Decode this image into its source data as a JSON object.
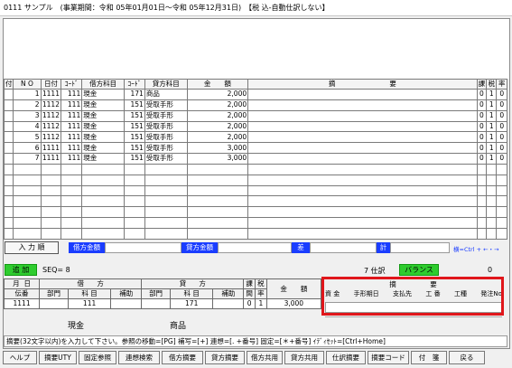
{
  "title": "0111 サンプル　(事業期間：令和 05年01月01日～令和 05年12月31日)　【税 込-自動仕訳しない】",
  "grid": {
    "headers": [
      "付",
      "N O",
      "日付",
      "ｺｰﾄﾞ",
      "借方科目",
      "ｺｰﾄﾞ",
      "貸方科目",
      "金　　額",
      "摘　　　　　　　　要",
      "課",
      "税",
      "率"
    ],
    "rows": [
      {
        "no": "1",
        "date": "1111",
        "dcode": "111",
        "dname": "現金",
        "ccode": "171",
        "cname": "商品",
        "amount": "2,000",
        "desc": "",
        "ka": "0",
        "zei": "1",
        "ritsu": "0"
      },
      {
        "no": "2",
        "date": "1112",
        "dcode": "111",
        "dname": "現金",
        "ccode": "151",
        "cname": "受取手形",
        "amount": "2,000",
        "desc": "",
        "ka": "0",
        "zei": "1",
        "ritsu": "0"
      },
      {
        "no": "3",
        "date": "1112",
        "dcode": "111",
        "dname": "現金",
        "ccode": "151",
        "cname": "受取手形",
        "amount": "2,000",
        "desc": "",
        "ka": "0",
        "zei": "1",
        "ritsu": "0"
      },
      {
        "no": "4",
        "date": "1112",
        "dcode": "111",
        "dname": "現金",
        "ccode": "151",
        "cname": "受取手形",
        "amount": "2,000",
        "desc": "",
        "ka": "0",
        "zei": "1",
        "ritsu": "0"
      },
      {
        "no": "5",
        "date": "1112",
        "dcode": "111",
        "dname": "現金",
        "ccode": "151",
        "cname": "受取手形",
        "amount": "2,000",
        "desc": "",
        "ka": "0",
        "zei": "1",
        "ritsu": "0"
      },
      {
        "no": "6",
        "date": "1111",
        "dcode": "111",
        "dname": "現金",
        "ccode": "151",
        "cname": "受取手形",
        "amount": "3,000",
        "desc": "",
        "ka": "0",
        "zei": "1",
        "ritsu": "0"
      },
      {
        "no": "7",
        "date": "1111",
        "dcode": "111",
        "dname": "現金",
        "ccode": "151",
        "cname": "受取手形",
        "amount": "3,000",
        "desc": "",
        "ka": "0",
        "zei": "1",
        "ritsu": "0"
      }
    ],
    "empty_rows": 7
  },
  "input_bar": {
    "order_button": "入 力 順",
    "debit_amount_label": "借方金額",
    "credit_amount_label": "貸方金額",
    "diff_label": "差",
    "total_label": "計",
    "shortcut": "横=Ctrl + ←・→"
  },
  "status": {
    "add_mode": "追 加",
    "seq": "SEQ= 8",
    "entry_count": "7 仕訳",
    "balance_button": "バランス",
    "balance_value": "0"
  },
  "entry": {
    "header1": [
      "月",
      "日",
      "借",
      "方",
      "貸",
      "方",
      "課",
      "税"
    ],
    "header2": [
      "伝番",
      "部門",
      "科 目",
      "補助",
      "部門",
      "科 目",
      "補助",
      "間",
      "率",
      "金　　額"
    ],
    "values": {
      "date": "1111",
      "dcode": "111",
      "ccode": "171",
      "ka": "0",
      "zei": "1",
      "amount": "3,000"
    },
    "debit_name": "現金",
    "credit_name": "商品",
    "tekiyo_title": "摘　　　　　要",
    "tekiyo_cols": [
      "資 金",
      "手形期日",
      "支払先",
      "工 番",
      "工種",
      "発注No"
    ]
  },
  "hint": "摘要(32文字以内)を入力して下さい。参照の移動=[PG] 補写=[+] 連想=[. +番号] 固定=[＊+番号] ｲﾃﾞｨｾｯﾄ=[Ctrl+Home]",
  "fkeys": [
    "ヘルプ",
    "摘要UTY",
    "固定参照",
    "連想検索",
    "借方摘要",
    "貸方摘要",
    "借方共用",
    "貸方共用",
    "仕訳摘要",
    "摘要コード",
    "付　箋",
    "戻る"
  ]
}
